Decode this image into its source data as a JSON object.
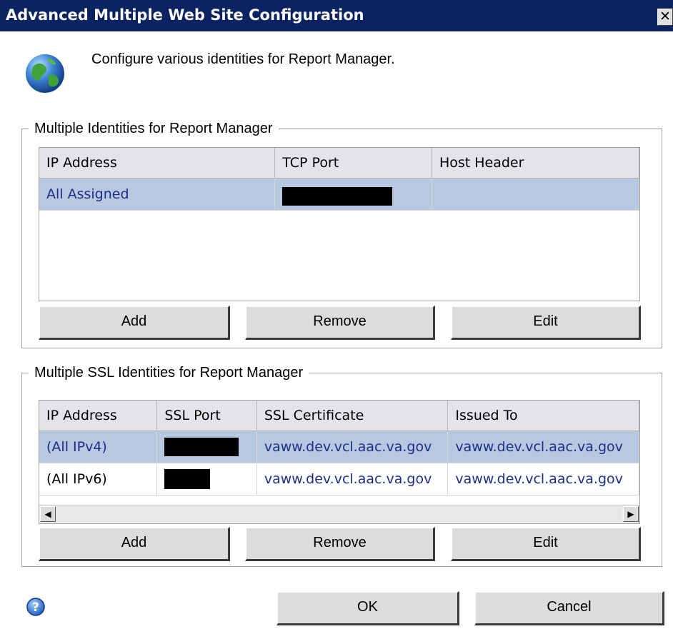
{
  "window": {
    "title": "Advanced Multiple Web Site Configuration",
    "close_glyph": "✕"
  },
  "intro": {
    "text": "Configure various identities for Report Manager.",
    "icon": "globe-icon"
  },
  "group1": {
    "title": "Multiple Identities for Report Manager",
    "columns": [
      "IP Address",
      "TCP Port",
      "Host Header"
    ],
    "rows": [
      {
        "ip": "All Assigned",
        "port": "[redacted]",
        "host": "",
        "selected": true
      }
    ],
    "buttons": {
      "add": "Add",
      "remove": "Remove",
      "edit": "Edit"
    }
  },
  "group2": {
    "title": "Multiple SSL Identities for Report Manager",
    "columns": [
      "IP Address",
      "SSL Port",
      "SSL Certificate",
      "Issued To"
    ],
    "rows": [
      {
        "ip": "(All IPv4)",
        "port": "[redacted]",
        "cert": "vaww.dev.vcl.aac.va.gov",
        "issued": "vaww.dev.vcl.aac.va.gov",
        "selected": true
      },
      {
        "ip": "(All IPv6)",
        "port": "[redacted]",
        "cert": "vaww.dev.vcl.aac.va.gov",
        "issued": "vaww.dev.vcl.aac.va.gov",
        "selected": false
      }
    ],
    "scroll": {
      "left_glyph": "◀",
      "right_glyph": "▶"
    },
    "buttons": {
      "add": "Add",
      "remove": "Remove",
      "edit": "Edit"
    }
  },
  "footer": {
    "help_icon": "help-icon",
    "ok": "OK",
    "cancel": "Cancel"
  },
  "colors": {
    "titlebar": "#0b2361",
    "selected_row": "#b7c8e0",
    "link_text": "#1a2f8a"
  }
}
